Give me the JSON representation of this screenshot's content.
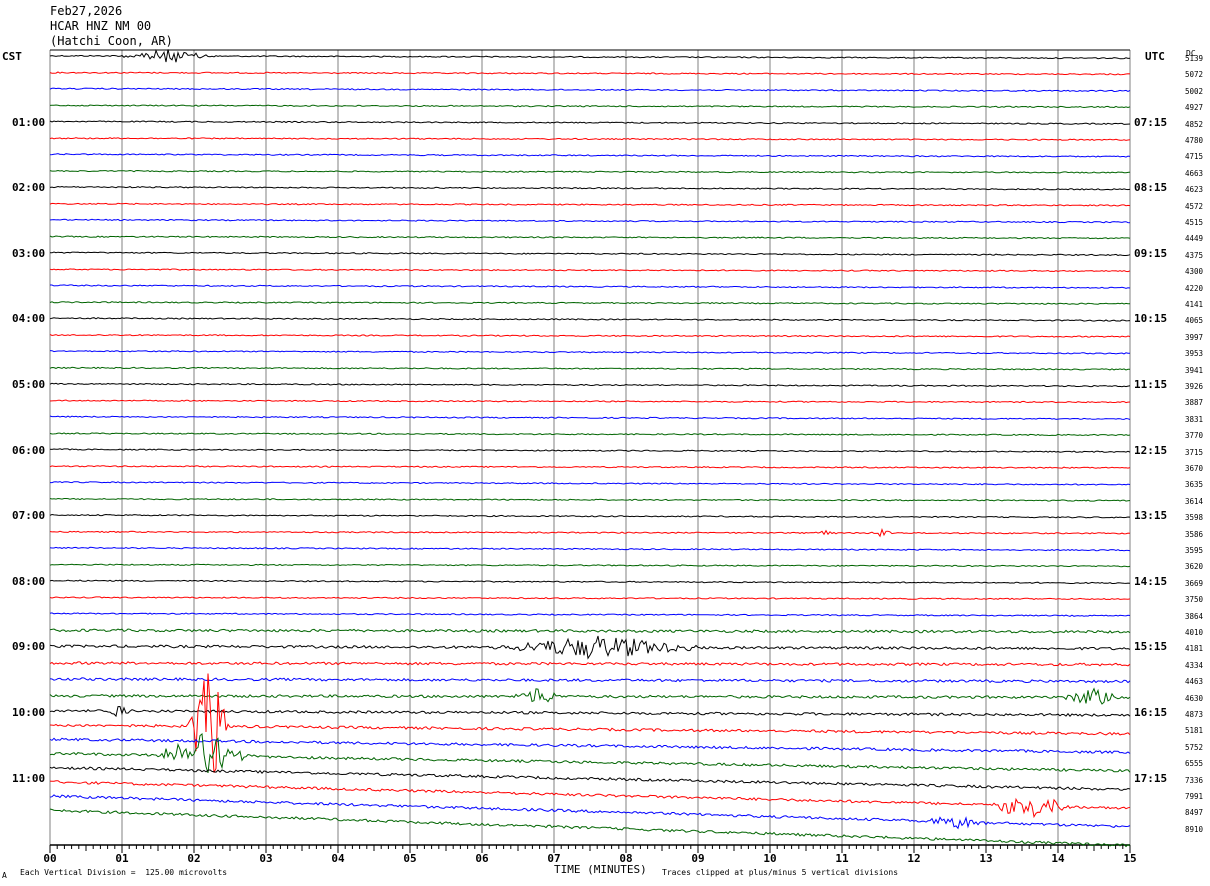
{
  "header": {
    "date": "Feb27,2026",
    "station": "HCAR HNZ NM 00",
    "location": "(Hatchi Coon, AR)"
  },
  "left_tz": "CST",
  "right_tz": "UTC",
  "dc_label": "DC",
  "footer": {
    "left_mark": "A",
    "scale_note": "Each Vertical Division =  125.00 microvolts",
    "axis_title": "TIME (MINUTES)",
    "clip_note": "Traces clipped at plus/minus 5 vertical divisions"
  },
  "colors": {
    "cycle": [
      "#000000",
      "#ff0000",
      "#0000ff",
      "#006400"
    ],
    "grid": "#808080"
  },
  "chart_data": {
    "type": "line",
    "title": "HCAR HNZ NM 00",
    "xlabel": "TIME (MINUTES)",
    "xlim": [
      0,
      15
    ],
    "x_ticks": [
      "00",
      "01",
      "02",
      "03",
      "04",
      "05",
      "06",
      "07",
      "08",
      "09",
      "10",
      "11",
      "12",
      "13",
      "14",
      "15"
    ],
    "trace_minutes": 15,
    "left_hour_labels": [
      "01:00",
      "02:00",
      "03:00",
      "04:00",
      "05:00",
      "06:00",
      "07:00",
      "08:00",
      "09:00",
      "10:00",
      "11:00"
    ],
    "right_hour_labels": [
      "07:15",
      "08:15",
      "09:15",
      "10:15",
      "11:15",
      "12:15",
      "13:15",
      "14:15",
      "15:15",
      "16:15",
      "17:15"
    ],
    "dc_offsets": [
      "5139",
      "5072",
      "5002",
      "4927",
      "4852",
      "4780",
      "4715",
      "4663",
      "4623",
      "4572",
      "4515",
      "4449",
      "4375",
      "4300",
      "4220",
      "4141",
      "4065",
      "3997",
      "3953",
      "3941",
      "3926",
      "3887",
      "3831",
      "3770",
      "3715",
      "3670",
      "3635",
      "3614",
      "3598",
      "3586",
      "3595",
      "3620",
      "3669",
      "3750",
      "3864",
      "4010",
      "4181",
      "4334",
      "4463",
      "4630",
      "4873",
      "5181",
      "5752",
      "6555",
      "7336",
      "7991",
      "8497",
      "8910"
    ],
    "events": [
      {
        "trace": 0,
        "minute": 1.6,
        "amplitude": 0.9,
        "duration_min": 0.7
      },
      {
        "trace": 29,
        "minute": 10.75,
        "amplitude": 0.35,
        "duration_min": 0.2
      },
      {
        "trace": 29,
        "minute": 11.55,
        "amplitude": 0.5,
        "duration_min": 0.2
      },
      {
        "trace": 36,
        "minute": 7.6,
        "amplitude": 1.5,
        "duration_min": 1.6
      },
      {
        "trace": 39,
        "minute": 6.75,
        "amplitude": 1.2,
        "duration_min": 0.4
      },
      {
        "trace": 40,
        "minute": 0.95,
        "amplitude": 0.8,
        "duration_min": 0.25
      },
      {
        "trace": 39,
        "minute": 14.5,
        "amplitude": 1.2,
        "duration_min": 0.5
      },
      {
        "trace": 41,
        "minute": 2.2,
        "amplitude": 8,
        "duration_min": 0.3
      },
      {
        "trace": 43,
        "minute": 2.15,
        "amplitude": 3,
        "duration_min": 0.7
      },
      {
        "trace": 45,
        "minute": 13.6,
        "amplitude": 1.8,
        "duration_min": 0.6
      },
      {
        "trace": 46,
        "minute": 12.6,
        "amplitude": 0.8,
        "duration_min": 0.5
      }
    ]
  }
}
